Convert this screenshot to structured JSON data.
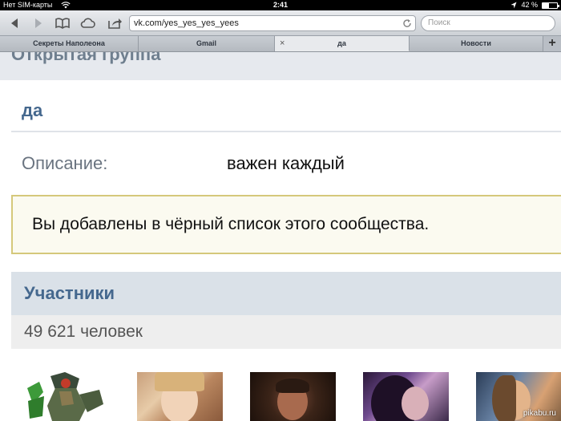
{
  "status_bar": {
    "carrier": "Нет SIM-карты",
    "time": "2:41",
    "battery": "42 %",
    "battery_level": 0.42
  },
  "toolbar": {
    "url": "vk.com/yes_yes_yes_yees",
    "search_placeholder": "Поиск"
  },
  "tabs": [
    {
      "label": "Секреты Наполеона",
      "active": false
    },
    {
      "label": "Gmail",
      "active": false
    },
    {
      "label": "да",
      "active": true
    },
    {
      "label": "Новости",
      "active": false
    }
  ],
  "tab_close_glyph": "×",
  "tab_add_glyph": "+",
  "page": {
    "group_type": "Открытая группа",
    "group_name": "да",
    "description_label": "Описание:",
    "description_value": "важен каждый",
    "blacklist_notice": "Вы добавлены в чёрный список этого сообщества.",
    "members_title": "Участники",
    "members_count": "49 621 человек"
  },
  "watermark": "pikabu.ru",
  "colors": {
    "vk_blue": "#45688e",
    "notice_border": "#d5c87b",
    "notice_bg": "#fbfaf0"
  }
}
